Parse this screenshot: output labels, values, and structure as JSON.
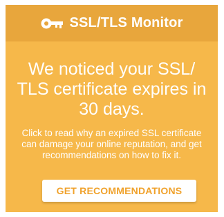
{
  "header": {
    "icon": "key-icon",
    "title": "SSL/TLS Monitor"
  },
  "main": {
    "headline": "We noticed your SSL/ TLS certificate expires in 30 days.",
    "body": "Click to read why an expired SSL certificate can damage your online reputation, and get recommendations on how to fix it."
  },
  "cta": {
    "label": "GET RECOMMENDATIONS"
  },
  "colors": {
    "card_background": "#f6b84a",
    "header_background": "#e8a63c",
    "button_text": "#f0a22c",
    "text": "#ffffff"
  }
}
